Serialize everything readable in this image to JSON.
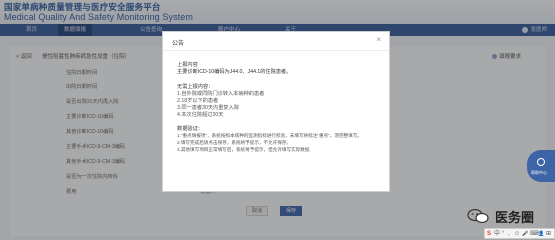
{
  "header": {
    "title_cn": "国家单病种质量管理与医疗安全服务平台",
    "title_en": "Medical Quality And Safety Monitoring System"
  },
  "nav": {
    "items": [
      "首页",
      "数据填报",
      "公告查询",
      "账户中心",
      "关于"
    ],
    "user": "张医师"
  },
  "page": {
    "back": "< 返回",
    "form_title": "慢性阻塞性肺疾病急性加重（住院）",
    "report_required": "填报要求",
    "fields": [
      {
        "label": "住院日期时间"
      },
      {
        "label": "出院日期时间"
      },
      {
        "label": "是否出院31天内再入院"
      },
      {
        "label": "主要诊断ICD-10编码"
      },
      {
        "label": "其他诊断ICD-10编码"
      },
      {
        "label": "主要手术ICD-9-CM-3编码"
      },
      {
        "label": "其他手术ICD-9-CM-3编码"
      },
      {
        "label": "是否为一次住院内转科"
      },
      {
        "label": "费用",
        "value": "请输入"
      }
    ],
    "cancel": "取消",
    "save": "保存"
  },
  "modal": {
    "title": "公告",
    "close": "×",
    "upload_heading": "上报内容",
    "upload_text": "主要诊断ICD-10编码为J44.0、J44.1的住院患者。",
    "no_upload_heading": "无需上报内容：",
    "no_upload_items": [
      "1.自外院或同院门诊转入本病种的患者",
      "2.18岁以下的患者",
      "3.同一患者30天内重复入院",
      "4.本次住院超过30天"
    ],
    "data_heading": "数据验证：",
    "data_items": [
      "1.\"重点填报项\"，系统按照本病种的监测指标进行校验，未填写将标注\"重点\"，须完整填写。",
      "2.填写完成后请点击保存，系统将予提示，不允许保存。",
      "3.其他填写项目正常填写后，系统将予提示，但允许填写实际数据"
    ]
  },
  "float_tab": {
    "label": "帮助中心"
  },
  "watermark": {
    "text": "医务圈"
  },
  "ime": {
    "items": [
      "S",
      "中",
      "°",
      ",",
      "☺",
      "🎤",
      "⌨",
      "👤",
      "⊞"
    ]
  },
  "colors": {
    "primary": "#33589a",
    "nav_active": "#1f3f7a",
    "button": "#3a62a8"
  }
}
